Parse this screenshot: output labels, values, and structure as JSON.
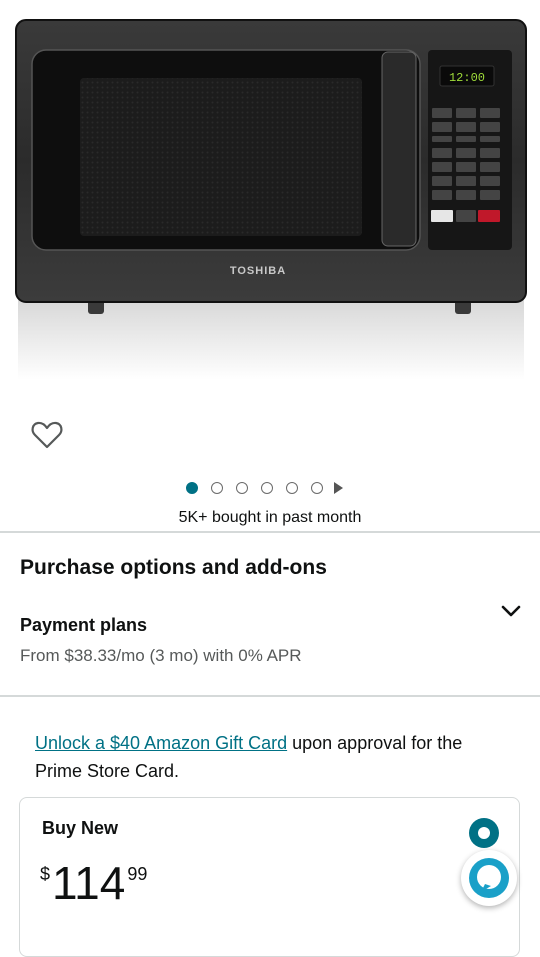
{
  "product": {
    "image_brand_text": "TOSHIBA",
    "display_time": "12:00"
  },
  "carousel": {
    "count": 6,
    "active_index": 0
  },
  "bought_text": "5K+ bought in past month",
  "purchase_options": {
    "heading": "Purchase options and add-ons",
    "payment_plans": {
      "title": "Payment plans",
      "detail": "From $38.33/mo (3 mo) with 0% APR"
    }
  },
  "gift_card": {
    "link_text": "Unlock a $40 Amazon Gift Card",
    "rest_text": " upon approval for the Prime Store Card."
  },
  "buy_box": {
    "label": "Buy New",
    "price_symbol": "$",
    "price_whole": "114",
    "price_fraction": "99"
  },
  "colors": {
    "link": "#007185",
    "divider": "#d5d9d9"
  }
}
